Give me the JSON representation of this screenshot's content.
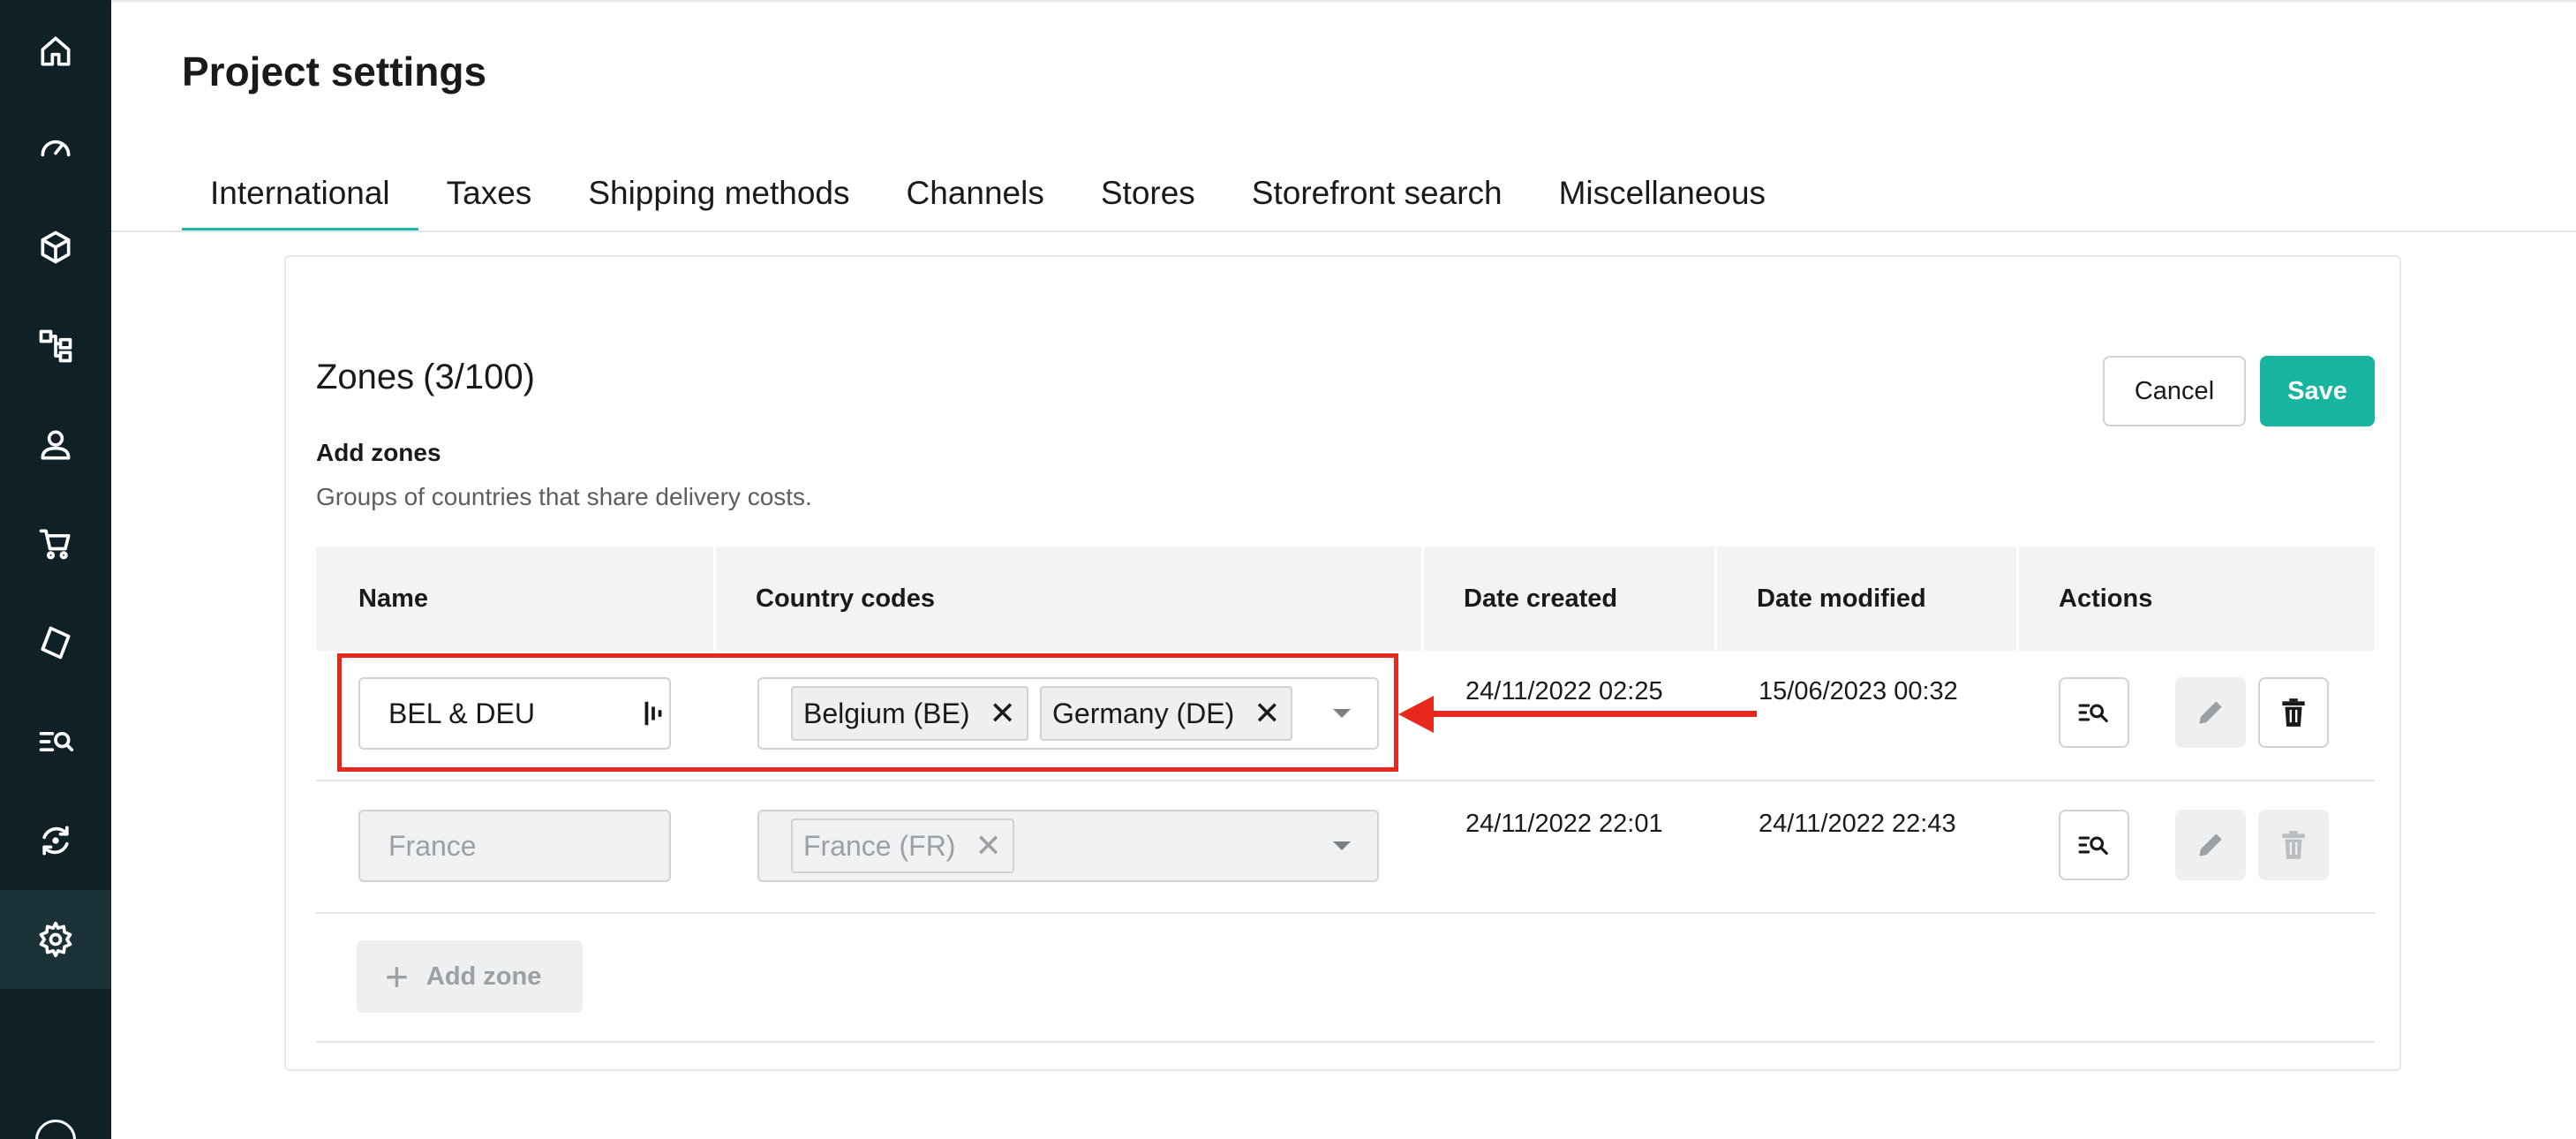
{
  "page": {
    "title": "Project settings"
  },
  "sidebar": {
    "items": [
      {
        "icon": "home-icon"
      },
      {
        "icon": "dashboard-icon"
      },
      {
        "icon": "products-icon"
      },
      {
        "icon": "categories-icon"
      },
      {
        "icon": "customers-icon"
      },
      {
        "icon": "orders-icon"
      },
      {
        "icon": "discounts-icon"
      },
      {
        "icon": "search-icon"
      },
      {
        "icon": "operations-icon"
      },
      {
        "icon": "settings-icon",
        "active": true
      },
      {
        "icon": "help-icon"
      }
    ]
  },
  "tabs": [
    {
      "label": "International",
      "active": true
    },
    {
      "label": "Taxes"
    },
    {
      "label": "Shipping methods"
    },
    {
      "label": "Channels"
    },
    {
      "label": "Stores"
    },
    {
      "label": "Storefront search"
    },
    {
      "label": "Miscellaneous"
    }
  ],
  "zones": {
    "title": "Zones",
    "count": "(3/100)",
    "add_label": "Add zones",
    "description": "Groups of countries that share delivery costs.",
    "cancel_label": "Cancel",
    "save_label": "Save",
    "add_zone_label": "Add zone"
  },
  "table": {
    "columns": [
      "Name",
      "Country codes",
      "Date created",
      "Date modified",
      "Actions"
    ],
    "rows": [
      {
        "name": "BEL & DEU",
        "chips": [
          "Belgium (BE)",
          "Germany (DE)"
        ],
        "date_created": "24/11/2022 02:25",
        "date_modified": "15/06/2023 00:32",
        "editable": true
      },
      {
        "name": "France",
        "chips": [
          "France (FR)"
        ],
        "date_created": "24/11/2022 22:01",
        "date_modified": "24/11/2022 22:43",
        "editable": false
      }
    ]
  },
  "colors": {
    "sidebar": "#0f2126",
    "accent": "#17b59f",
    "annotation": "#e8281c"
  }
}
